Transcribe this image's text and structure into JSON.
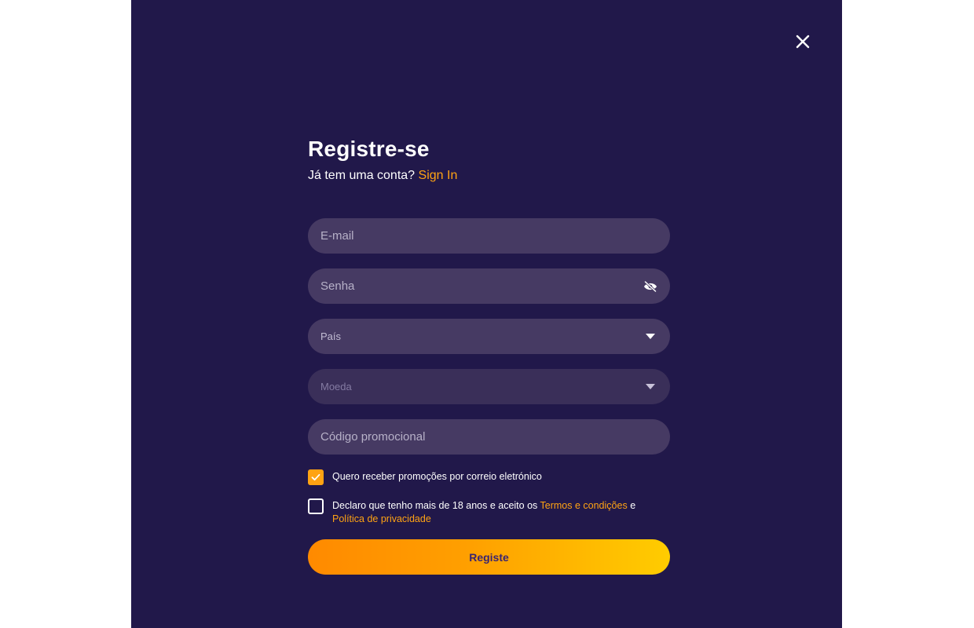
{
  "modal": {
    "close_icon": "close-icon",
    "title": "Registre-se",
    "subtitle_prefix": "Já tem uma conta?",
    "signin_link": "Sign In",
    "fields": {
      "email_placeholder": "E-mail",
      "password_placeholder": "Senha",
      "password_icon": "eye-off-icon",
      "country_label": "País",
      "currency_label": "Moeda",
      "promo_placeholder": "Código promocional"
    },
    "checkboxes": {
      "promo_email": {
        "checked": true,
        "label": "Quero receber promoções por correio eletrónico"
      },
      "terms": {
        "checked": false,
        "text_prefix": "Declaro que tenho mais de 18 anos e aceito os",
        "terms_link": "Termos e condições",
        "connector": "e",
        "privacy_link": "Política de privacidade"
      }
    },
    "submit_label": "Registe"
  },
  "colors": {
    "modal_background": "#21184a",
    "field_background": "#463a63",
    "accent": "#ffa313",
    "button_gradient_start": "#ff8a00",
    "button_gradient_end": "#ffcc00"
  }
}
